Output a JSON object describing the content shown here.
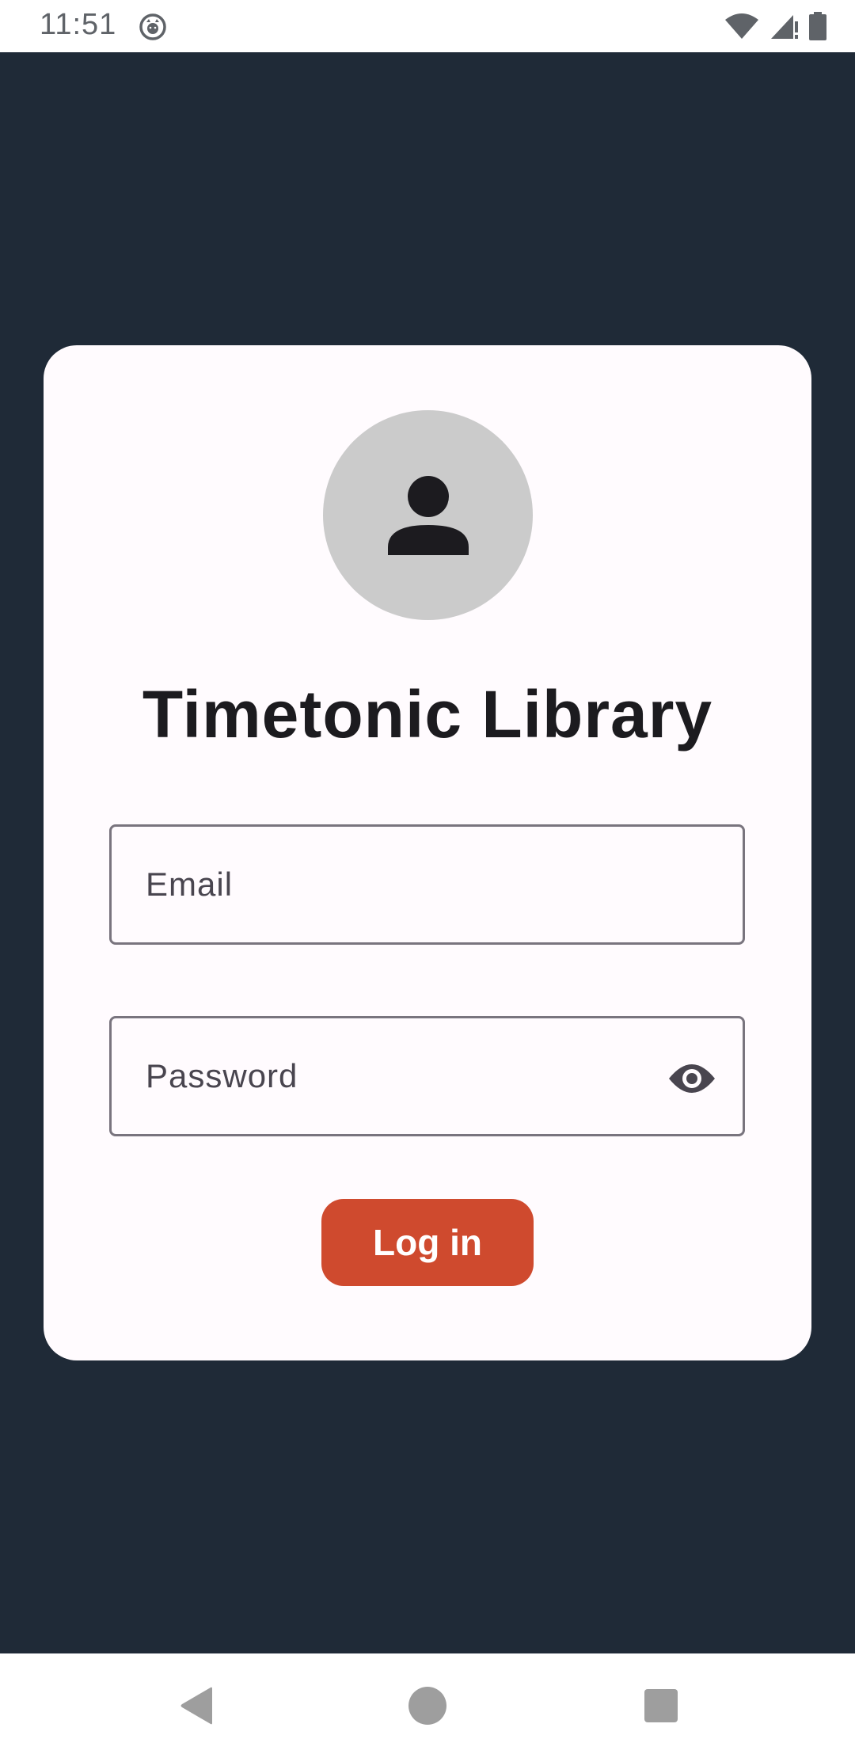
{
  "status_bar": {
    "time": "11:51",
    "icons": [
      "cat-notification-icon",
      "wifi-icon",
      "signal-icon",
      "battery-icon"
    ]
  },
  "app": {
    "title": "Timetonic Library",
    "avatar_icon": "person-icon",
    "email_placeholder": "Email",
    "password_placeholder": "Password",
    "password_toggle_icon": "eye-icon",
    "login_label": "Log in"
  },
  "nav": {
    "icons": [
      "back-icon",
      "home-icon",
      "recents-icon"
    ]
  },
  "colors": {
    "background": "#1f2a37",
    "card": "#fffbfe",
    "accent": "#cf4a2e",
    "avatar": "#cbcbcb"
  }
}
